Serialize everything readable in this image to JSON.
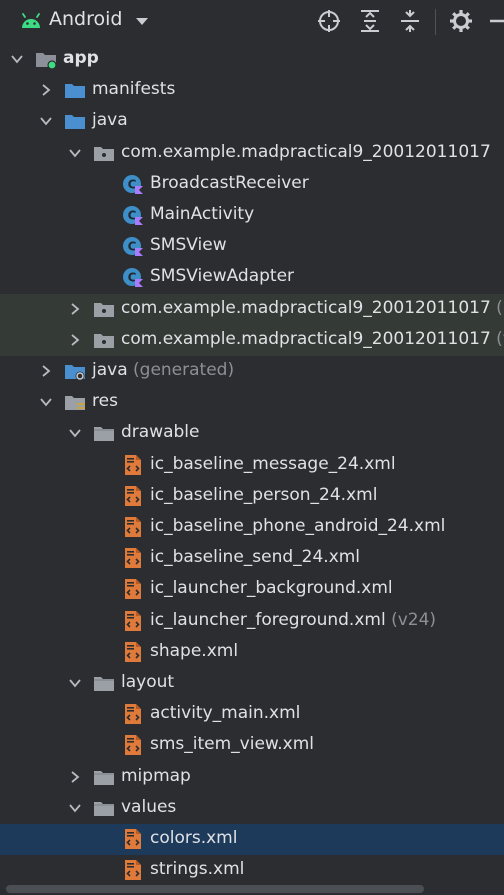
{
  "toolbar": {
    "view_label": "Android",
    "icons": [
      "android-icon",
      "dropdown-caret-icon",
      "locate-icon",
      "expand-all-icon",
      "collapse-all-icon",
      "gear-icon",
      "minimize-icon"
    ]
  },
  "tree": [
    {
      "label": "app",
      "depth": 0,
      "expanded": true,
      "icon": "module-folder",
      "bold": true
    },
    {
      "label": "manifests",
      "depth": 1,
      "expanded": false,
      "icon": "folder-blue"
    },
    {
      "label": "java",
      "depth": 1,
      "expanded": true,
      "icon": "folder-blue"
    },
    {
      "label": "com.example.madpractical9_20012011017",
      "depth": 2,
      "expanded": true,
      "icon": "package"
    },
    {
      "label": "BroadcastReceiver",
      "depth": 3,
      "icon": "kotlin-class"
    },
    {
      "label": "MainActivity",
      "depth": 3,
      "icon": "kotlin-class"
    },
    {
      "label": "SMSView",
      "depth": 3,
      "icon": "kotlin-class"
    },
    {
      "label": "SMSViewAdapter",
      "depth": 3,
      "icon": "kotlin-class"
    },
    {
      "label": "com.example.madpractical9_20012011017",
      "hint": "(an",
      "depth": 2,
      "expanded": false,
      "icon": "package",
      "highlight": true
    },
    {
      "label": "com.example.madpractical9_20012011017",
      "hint": "(tes",
      "depth": 2,
      "expanded": false,
      "icon": "package",
      "highlight": true
    },
    {
      "label": "java",
      "hint": "(generated)",
      "depth": 1,
      "expanded": false,
      "icon": "folder-generated"
    },
    {
      "label": "res",
      "depth": 1,
      "expanded": true,
      "icon": "folder-res"
    },
    {
      "label": "drawable",
      "depth": 2,
      "expanded": true,
      "icon": "folder-gray"
    },
    {
      "label": "ic_baseline_message_24.xml",
      "depth": 3,
      "icon": "xml-file"
    },
    {
      "label": "ic_baseline_person_24.xml",
      "depth": 3,
      "icon": "xml-file"
    },
    {
      "label": "ic_baseline_phone_android_24.xml",
      "depth": 3,
      "icon": "xml-file"
    },
    {
      "label": "ic_baseline_send_24.xml",
      "depth": 3,
      "icon": "xml-file"
    },
    {
      "label": "ic_launcher_background.xml",
      "depth": 3,
      "icon": "xml-file"
    },
    {
      "label": "ic_launcher_foreground.xml",
      "hint": "(v24)",
      "depth": 3,
      "icon": "xml-file"
    },
    {
      "label": "shape.xml",
      "depth": 3,
      "icon": "xml-file"
    },
    {
      "label": "layout",
      "depth": 2,
      "expanded": true,
      "icon": "folder-gray"
    },
    {
      "label": "activity_main.xml",
      "depth": 3,
      "icon": "xml-file"
    },
    {
      "label": "sms_item_view.xml",
      "depth": 3,
      "icon": "xml-file"
    },
    {
      "label": "mipmap",
      "depth": 2,
      "expanded": false,
      "icon": "folder-gray"
    },
    {
      "label": "values",
      "depth": 2,
      "expanded": true,
      "icon": "folder-gray"
    },
    {
      "label": "colors.xml",
      "depth": 3,
      "icon": "xml-file",
      "selected": true
    },
    {
      "label": "strings.xml",
      "depth": 3,
      "icon": "xml-file"
    }
  ]
}
